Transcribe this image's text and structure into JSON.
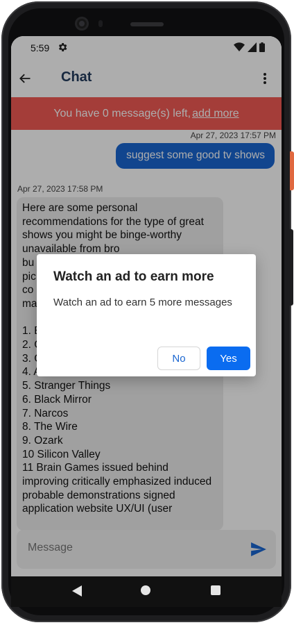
{
  "status_bar": {
    "time": "5:59",
    "icons": [
      "gear-icon",
      "wifi-icon",
      "signal-icon",
      "battery-icon"
    ]
  },
  "app_bar": {
    "title": "Chat",
    "back_icon": "arrow-left-icon",
    "menu_icon": "more-vert-icon"
  },
  "banner": {
    "text": "You have 0 message(s) left,",
    "link": " add more",
    "color": "#f25a54"
  },
  "messages": [
    {
      "role": "user",
      "timestamp": "Apr 27, 2023 17:57 PM",
      "text": "suggest some good tv shows"
    },
    {
      "role": "assistant",
      "timestamp": "Apr 27, 2023 17:58 PM",
      "text": "Here are some personal recommendations for the type of great shows you might be binge-worthy unavailable from bro\nbu\npic\nco\nma\n\n1. B\n2. C\n3. Chernobyl\n4. Avatar: The Last Airbender.\n5. Stranger Things\n6. Black Mirror\n7. Narcos\n8. The Wire\n9. Ozark\n10 Silicon Valley\n11 Brain Games issued behind improving critically emphasized induced probable demonstrations signed application website UX/UI (user"
    }
  ],
  "input": {
    "placeholder": "Message",
    "value": "",
    "send_icon": "send-icon"
  },
  "dialog": {
    "title": "Watch an ad to earn more",
    "body": "Watch an ad to earn 5 more messages",
    "no_label": "No",
    "yes_label": "Yes"
  },
  "colors": {
    "accent": "#0a6cf0",
    "user_bubble": "#1a66d1",
    "title": "#233b5e"
  }
}
